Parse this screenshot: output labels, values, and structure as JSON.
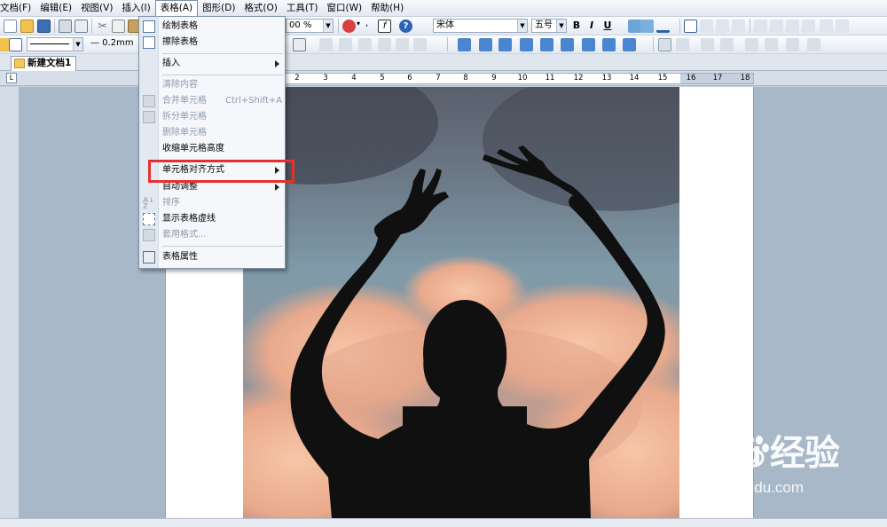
{
  "menubar": {
    "items": [
      "文档(F)",
      "编辑(E)",
      "视图(V)",
      "插入(I)",
      "表格(A)",
      "图形(D)",
      "格式(O)",
      "工具(T)",
      "窗口(W)",
      "帮助(H)"
    ],
    "active_index": 4
  },
  "toolbar": {
    "zoom_value": "00 %",
    "font_name": "宋体",
    "font_size": "五号",
    "bold_label": "B",
    "italic_label": "I",
    "underline_label": "U",
    "line_width_value": "— 0.2mm"
  },
  "tab": {
    "label": "新建文档1"
  },
  "ruler": {
    "ticks": [
      "2",
      "3",
      "4",
      "5",
      "6",
      "7",
      "8",
      "9",
      "10",
      "11",
      "12",
      "13",
      "14",
      "15",
      "16",
      "17",
      "18"
    ]
  },
  "table_menu": {
    "items": [
      {
        "label": "绘制表格",
        "enabled": true,
        "icon": "pencil-table-icon"
      },
      {
        "label": "擦除表格",
        "enabled": true,
        "icon": "eraser-table-icon"
      },
      {
        "label": "插入",
        "enabled": true,
        "submenu": true
      },
      {
        "label": "清除内容",
        "enabled": false
      },
      {
        "label": "合并单元格",
        "shortcut": "Ctrl+Shift+A",
        "enabled": false,
        "icon": "merge-cells-icon"
      },
      {
        "label": "拆分单元格",
        "enabled": false,
        "icon": "split-cells-icon"
      },
      {
        "label": "删除单元格",
        "enabled": false
      },
      {
        "label": "收缩单元格高度",
        "enabled": true
      },
      {
        "label": "单元格对齐方式",
        "enabled": true,
        "submenu": true,
        "highlighted": true
      },
      {
        "label": "自动调整",
        "enabled": true,
        "submenu": true
      },
      {
        "label": "排序",
        "enabled": false,
        "icon": "sort-az-icon"
      },
      {
        "label": "显示表格虚线",
        "enabled": true,
        "icon": "table-grid-icon"
      },
      {
        "label": "套用格式...",
        "enabled": false,
        "icon": "table-format-icon"
      },
      {
        "label": "表格属性",
        "enabled": true,
        "icon": "table-properties-icon"
      }
    ]
  },
  "watermark": {
    "logo": "Bai  u 经验",
    "url": "jingyan.baidu.com"
  },
  "colors": {
    "highlight": "#e5302f",
    "menu_bg": "#f5f7fa"
  }
}
